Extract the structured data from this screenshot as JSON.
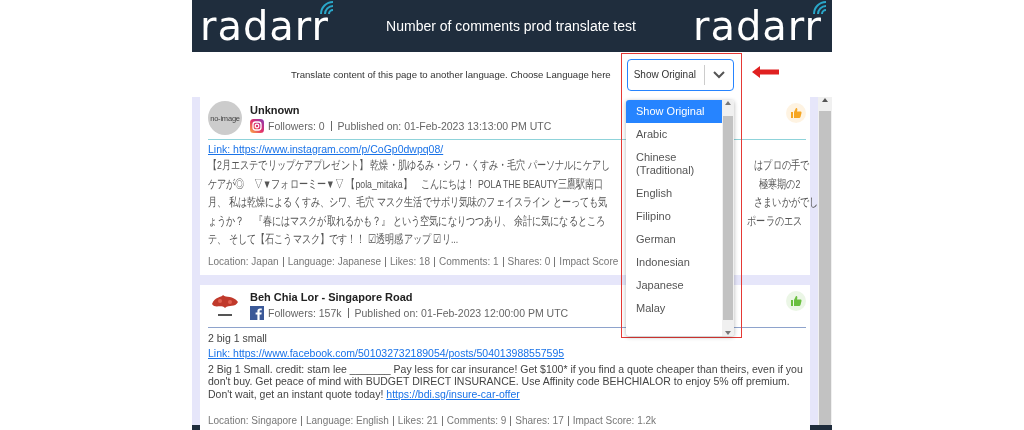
{
  "header": {
    "logo_left": "radarr",
    "title": "Number of comments prod translate test",
    "logo_right": "radarr"
  },
  "translate_bar": {
    "label": "Translate content of this page to another language. Choose Language here",
    "value": "Show Original"
  },
  "language_dropdown": {
    "options": [
      {
        "label": "Show Original",
        "selected": true
      },
      {
        "label": "Arabic",
        "selected": false
      },
      {
        "label": "Chinese (Traditional)",
        "selected": false
      },
      {
        "label": "English",
        "selected": false
      },
      {
        "label": "Filipino",
        "selected": false
      },
      {
        "label": "German",
        "selected": false
      },
      {
        "label": "Indonesian",
        "selected": false
      },
      {
        "label": "Japanese",
        "selected": false
      },
      {
        "label": "Malay",
        "selected": false
      }
    ]
  },
  "posts": [
    {
      "avatar_text": "no-image",
      "author": "Unknown",
      "kind": "instagram",
      "followers": "Followers: 0",
      "published": "Published on: 01-Feb-2023 13:13:00 PM UTC",
      "color": "#f6a623",
      "link": "Link: https://www.instagram.com/p/CoGp0dwpq08/",
      "body_lines": [
        {
          "left": "【2月エステでリップケアプレゼント】 乾燥・肌ゆるみ・シワ・くすみ・毛穴 パーソナルにケアし",
          "right": "はプロの手で"
        },
        {
          "left": "ケアが◎　▽▼フォローミー▼▽ 【pola_mitaka】　こんにちは！ POLA THE BEAUTY三鷹駅南口",
          "right": "極寒期の2"
        },
        {
          "left": "月、 私は乾燥によるくすみ、シワ、毛穴 マスク生活でサボリ気味のフェイスライン とーっても気",
          "right": "さまいかがでし"
        },
        {
          "left": "ょうか？　『春にはマスクが取れるかも？』 という空気になりつつあり、 余計に気になるところ",
          "right": "ポーラのエス"
        },
        {
          "left": "テ、 そして【石こうマスク】です！！ ☑透明感アップ ☑リ..."
        }
      ],
      "meta": [
        "Location: Japan",
        "Language: Japanese",
        "Likes: 18",
        "Comments: 1",
        "Shares: 0",
        "Impact Score"
      ]
    },
    {
      "author": "Beh Chia Lor - Singapore Road",
      "kind": "facebook",
      "followers": "Followers: 157k",
      "published": "Published on: 01-Feb-2023 12:00:00 PM UTC",
      "color": "#6abf40",
      "title": "2 big 1 small",
      "link": "Link: https://www.facebook.com/501032732189054/posts/504013988557595",
      "body": "2 Big 1 Small. credit: stam lee _______ Pay less for car insurance! Get $100* if you find a quote cheaper than theirs, even if you don't buy. Get peace of mind with BUDGET DIRECT INSURANCE. Use Affinity code BEHCHIALOR to enjoy 5% off premium. Don't wait, get an instant quote today!",
      "body_link": "https://bdi.sg/insure-car-offer",
      "meta": [
        "Location: Singapore",
        "Language: English",
        "Likes: 21",
        "Comments: 9",
        "Shares: 17",
        "Impact Score: 1.2k"
      ]
    }
  ]
}
